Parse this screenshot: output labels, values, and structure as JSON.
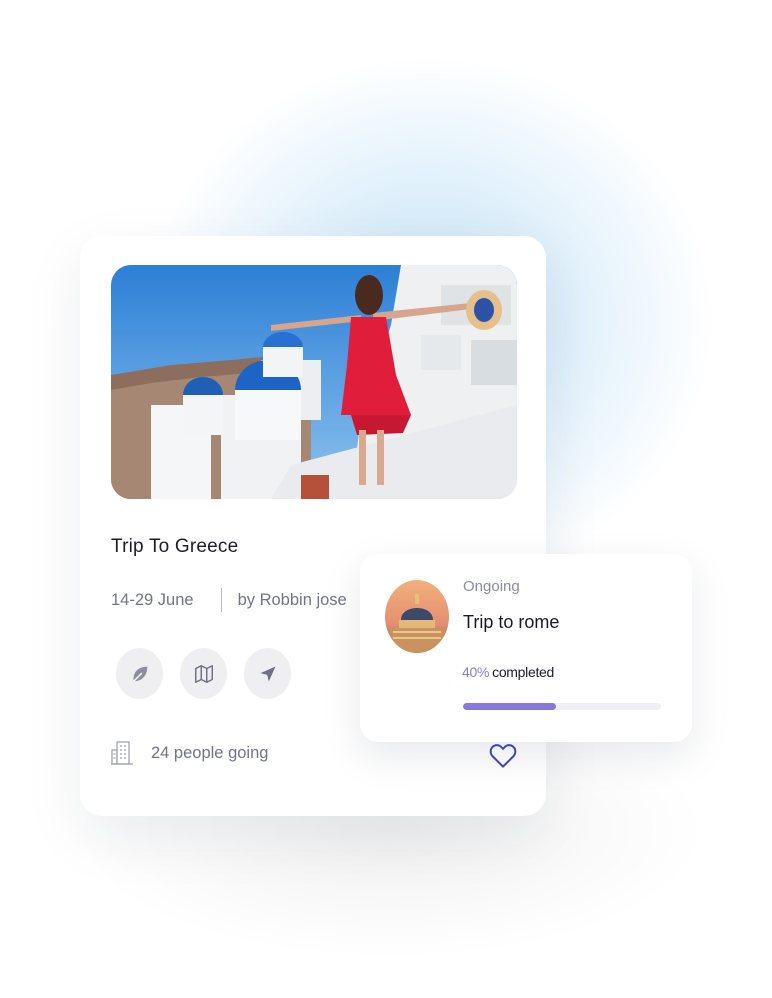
{
  "trip_card": {
    "title": "Trip To Greece",
    "dates": "14-29 June",
    "author": "by Robbin jose",
    "actions": [
      {
        "icon": "leaf-icon"
      },
      {
        "icon": "map-icon"
      },
      {
        "icon": "send-icon"
      }
    ],
    "people": "24 people going",
    "people_icon": "building-icon",
    "favorite_icon": "heart-icon",
    "accent_color": "#3b4bbd"
  },
  "ongoing_card": {
    "status": "Ongoing",
    "title": "Trip to rome",
    "progress_percent_label": "40%",
    "progress_suffix": "completed",
    "progress_value": 0.47,
    "progress_color": "#8877dc"
  }
}
